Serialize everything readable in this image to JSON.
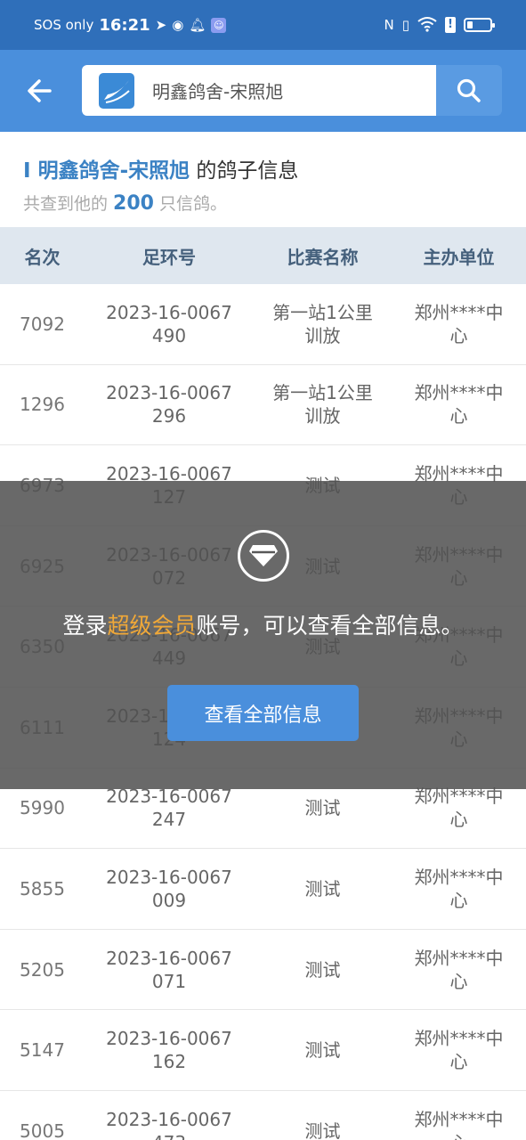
{
  "status_bar": {
    "carrier": "SOS only",
    "time": "16:21",
    "left_icons": [
      "telegram-icon",
      "discord-icon",
      "bell-icon",
      "app-icon"
    ],
    "right_icons": [
      "nfc-icon",
      "vibrate-icon",
      "wifi-icon",
      "alert-icon",
      "battery-icon"
    ]
  },
  "header": {
    "search_value": "明鑫鸽舍-宋照旭"
  },
  "info": {
    "marker": "I ",
    "name": "明鑫鸽舍-宋照旭",
    "title_suffix": " 的鸽子信息",
    "sub_prefix": "共查到他的 ",
    "count": "200",
    "sub_suffix": " 只信鸽。"
  },
  "table": {
    "headers": [
      "名次",
      "足环号",
      "比赛名称",
      "主办单位"
    ],
    "rows": [
      {
        "rank": "7092",
        "ring": "2023-16-0067\n490",
        "race": "第一站1公里\n训放",
        "org": "郑州****中\n心"
      },
      {
        "rank": "1296",
        "ring": "2023-16-0067\n296",
        "race": "第一站1公里\n训放",
        "org": "郑州****中\n心"
      },
      {
        "rank": "6973",
        "ring": "2023-16-0067\n127",
        "race": "测试",
        "org": "郑州****中\n心"
      },
      {
        "rank": "6925",
        "ring": "2023-16-0067\n072",
        "race": "测试",
        "org": "郑州****中\n心"
      },
      {
        "rank": "6350",
        "ring": "2023-16-0067\n449",
        "race": "测试",
        "org": "郑州****中\n心"
      },
      {
        "rank": "6111",
        "ring": "2023-16-0067\n124",
        "race": "测试",
        "org": "郑州****中\n心"
      },
      {
        "rank": "5990",
        "ring": "2023-16-0067\n247",
        "race": "测试",
        "org": "郑州****中\n心"
      },
      {
        "rank": "5855",
        "ring": "2023-16-0067\n009",
        "race": "测试",
        "org": "郑州****中\n心"
      },
      {
        "rank": "5205",
        "ring": "2023-16-0067\n071",
        "race": "测试",
        "org": "郑州****中\n心"
      },
      {
        "rank": "5147",
        "ring": "2023-16-0067\n162",
        "race": "测试",
        "org": "郑州****中\n心"
      },
      {
        "rank": "5005",
        "ring": "2023-16-0067\n473",
        "race": "测试",
        "org": "郑州****中\n心"
      }
    ]
  },
  "overlay": {
    "text_prefix": "登录",
    "text_highlight": "超级会员",
    "text_suffix": "账号，可以查看全部信息。",
    "button_label": "查看全部信息"
  },
  "colors": {
    "header": "#4a8fdc",
    "status_bar": "#2f6fba",
    "accent": "#3b82c4",
    "highlight": "#f0a838"
  }
}
